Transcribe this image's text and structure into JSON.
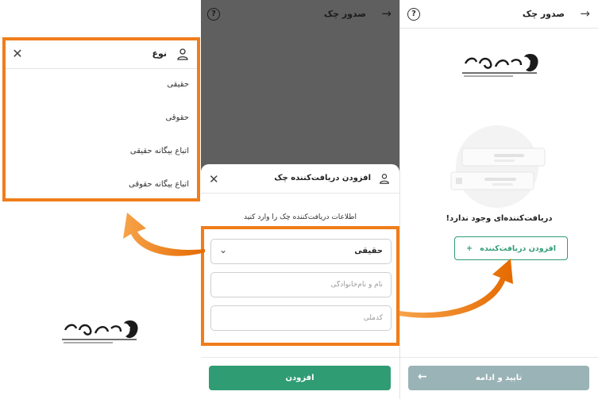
{
  "type_menu": {
    "title": "نوع",
    "options": [
      "حقیقی",
      "حقوقی",
      "اتباع بیگانه حقیقی",
      "اتباع بیگانه حقوقی"
    ]
  },
  "middle": {
    "title": "صدور چک",
    "sheet_title": "افزودن دریافت‌کننده چک",
    "instructions": "اطلاعات دریافت‌کننده چک را وارد کنید",
    "selected_type": "حقیقی",
    "name_placeholder": "نام و نام‌خانوادگی",
    "id_placeholder": "کدملی",
    "add_button": "افزودن"
  },
  "right": {
    "title": "صدور چک",
    "empty_text": "دریافت‌کننده‌ای وجود ندارد!",
    "add_recipient_button": "افزودن دریافت‌کننده",
    "confirm_button": "تایید و ادامه"
  },
  "colors": {
    "accent": "#f07d1a",
    "primary": "#2f9c74",
    "disabled": "#9ab3b6"
  }
}
